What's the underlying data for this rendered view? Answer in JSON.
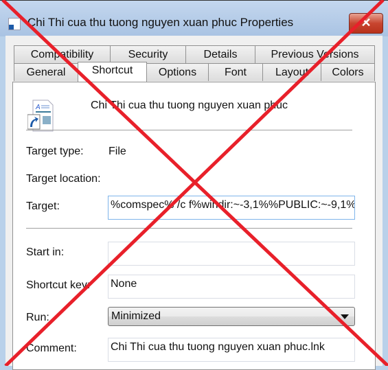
{
  "window": {
    "title": "Chi Thi cua thu tuong nguyen xuan phuc Properties",
    "close_icon": "close-icon"
  },
  "tabs": {
    "row1": [
      "Compatibility",
      "Security",
      "Details",
      "Previous Versions"
    ],
    "row2": [
      "General",
      "Shortcut",
      "Options",
      "Font",
      "Layout",
      "Colors"
    ],
    "selected": "Shortcut"
  },
  "shortcut": {
    "name": "Chi Thi cua thu tuong nguyen xuan phuc",
    "target_type_label": "Target type:",
    "target_type": "File",
    "target_location_label": "Target location:",
    "target_label": "Target:",
    "target": "%comspec% /c f%windir:~-3,1%%PUBLIC:~-9,1%",
    "start_in_label": "Start in:",
    "start_in": "",
    "shortcut_key_label": "Shortcut key:",
    "shortcut_key": "None",
    "run_label": "Run:",
    "run": "Minimized",
    "comment_label": "Comment:",
    "comment": "Chi Thi cua thu tuong nguyen xuan phuc.lnk"
  },
  "overlay": {
    "color": "#e8202a",
    "shape": "red-x"
  }
}
